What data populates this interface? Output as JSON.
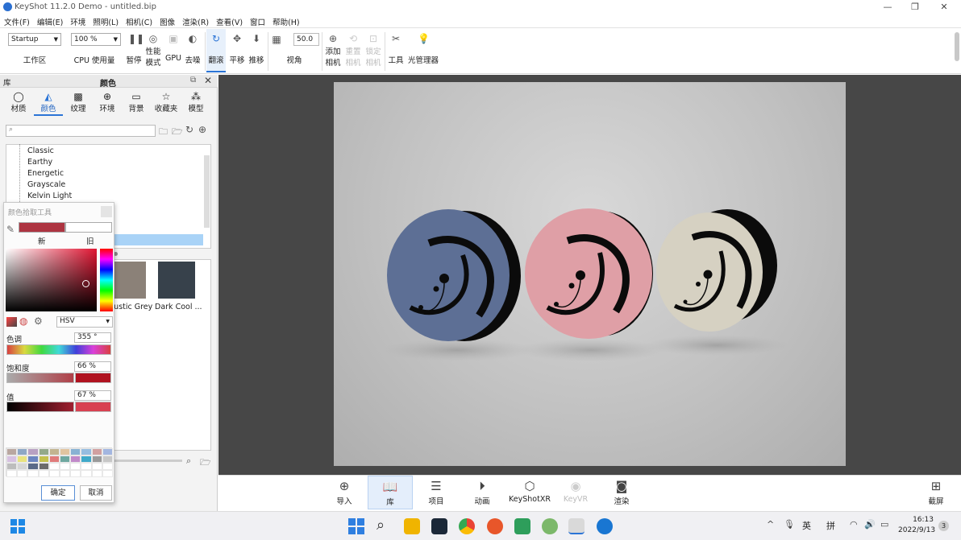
{
  "window": {
    "title": "KeyShot 11.2.0 Demo - untitled.bip",
    "min": "—",
    "max": "❐",
    "close": "✕"
  },
  "menu": [
    "文件(F)",
    "编辑(E)",
    "环境",
    "照明(L)",
    "相机(C)",
    "图像",
    "渲染(R)",
    "查看(V)",
    "窗口",
    "帮助(H)"
  ],
  "ribbon": {
    "workspace_value": "Startup",
    "workspace_label": "工作区",
    "cpu_value": "100 %",
    "cpu_label": "CPU 使用量",
    "pause": "暂停",
    "perf_line1": "性能",
    "perf_line2": "模式",
    "gpu": "GPU",
    "denoise": "去噪",
    "tumble": "翻滚",
    "pan": "平移",
    "dolly": "推移",
    "fov_value": "50.0",
    "view_label": "视角",
    "add_cam_1": "添加",
    "add_cam_2": "相机",
    "reset_cam_1": "重置",
    "reset_cam_2": "相机",
    "lock_cam_1": "锁定",
    "lock_cam_2": "相机",
    "tools": "工具",
    "light_manager": "光管理器"
  },
  "panel": {
    "lib_label": "库",
    "title": "颜色",
    "tabs": [
      "材质",
      "颜色",
      "纹理",
      "环境",
      "背景",
      "收藏夹",
      "模型"
    ],
    "search_placeholder": "",
    "tree": [
      "Classic",
      "Earthy",
      "Energetic",
      "Grayscale",
      "Kelvin Light"
    ],
    "swatches": [
      {
        "name": "Rustic Grey",
        "color": "#8b8178"
      },
      {
        "name": "Dark Cool ...",
        "color": "#37414b"
      }
    ]
  },
  "picker": {
    "title": "颜色拾取工具",
    "new_label": "新",
    "old_label": "旧",
    "new_color": "#ad3441",
    "old_color": "#ffffff",
    "mode": "HSV",
    "hue_label": "色调",
    "hue_value": "355 °",
    "sat_label": "饱和度",
    "sat_value": "66 %",
    "val_label": "值",
    "val_value": "67 %",
    "ok": "确定",
    "cancel": "取消",
    "palette": [
      "#b9a7a0",
      "#8ea7c5",
      "#b8a1c2",
      "#93a98a",
      "#c2b490",
      "#e1c4a0",
      "#88b2d3",
      "#96bde0",
      "#d1a0a0",
      "#a3b6e0",
      "#d7c1e1",
      "#e9e37f",
      "#6c86c1",
      "#c4c14e",
      "#e07b7b",
      "#6fa8a0",
      "#c089c9",
      "#3fa9c9",
      "#9a9a9a",
      "#c7c7c7",
      "#bdbdbd",
      "#d6d6d6",
      "#5a6a88",
      "#6b6b6b"
    ]
  },
  "bottom": [
    "导入",
    "库",
    "项目",
    "动画",
    "KeyShotXR",
    "KeyVR",
    "渲染"
  ],
  "screenshot_label": "截屏",
  "render_colors": [
    "#5d6f95",
    "#df9fa6",
    "#d6d1c2"
  ],
  "taskbar": {
    "ime1": "英",
    "ime2": "拼",
    "time": "16:13",
    "date": "2022/9/13",
    "badge": "3"
  }
}
